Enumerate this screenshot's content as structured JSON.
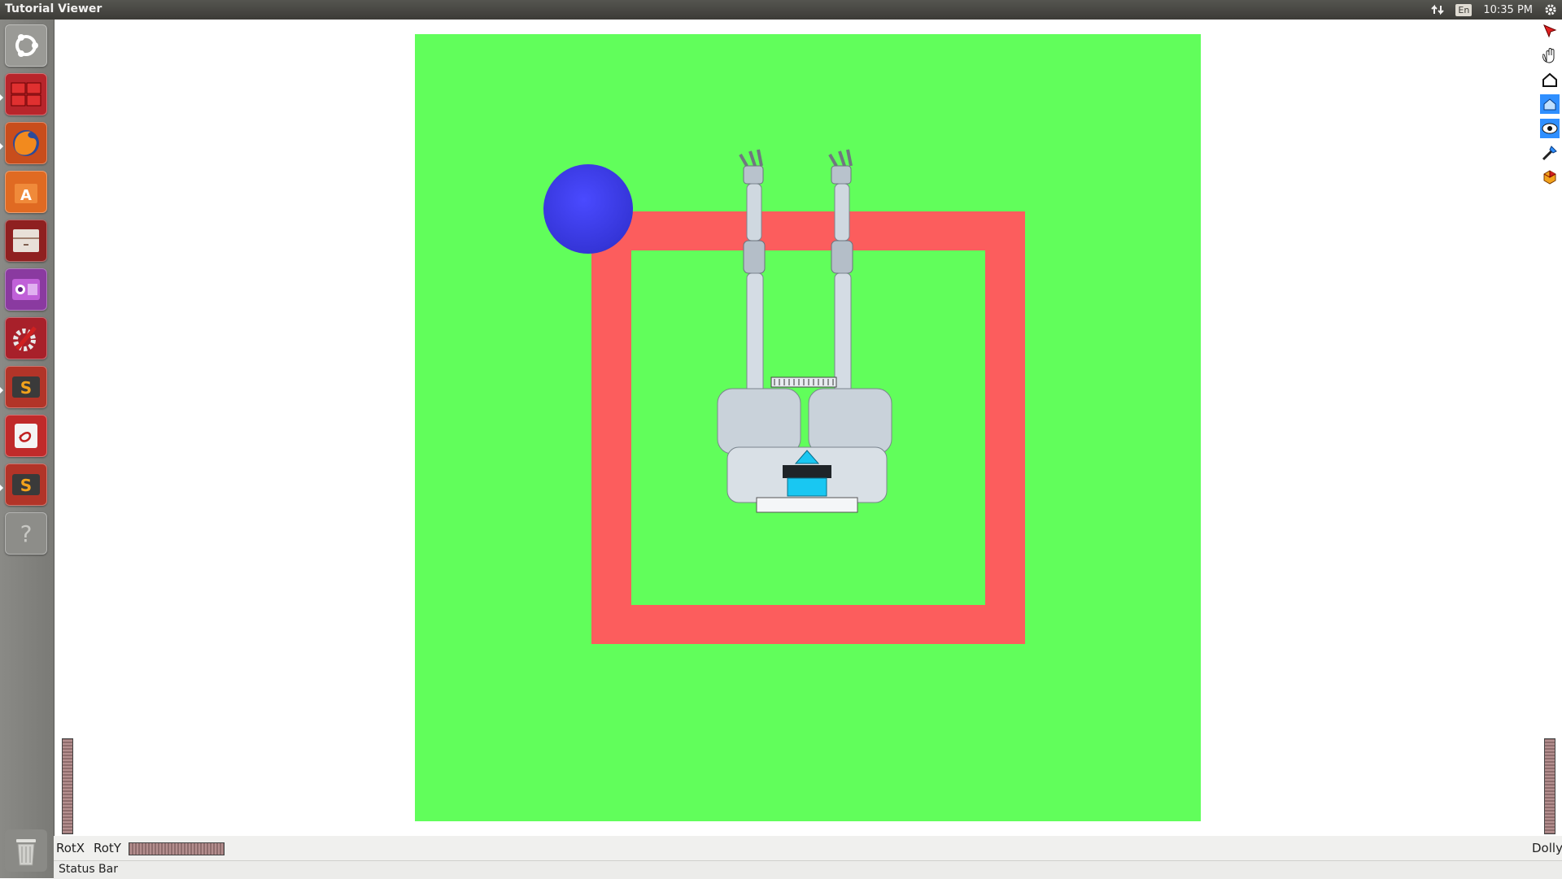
{
  "window": {
    "title": "Tutorial Viewer"
  },
  "topbar": {
    "lang": "En",
    "time": "10:35 PM"
  },
  "launcher": {
    "items": [
      {
        "name": "dash",
        "color": "#9a9a96"
      },
      {
        "name": "workspace",
        "color": "#b8252b"
      },
      {
        "name": "firefox",
        "color": "#c84d1c"
      },
      {
        "name": "software-center",
        "color": "#e06a22"
      },
      {
        "name": "files",
        "color": "#8f2020"
      },
      {
        "name": "camera",
        "color": "#8a3aa0"
      },
      {
        "name": "settings",
        "color": "#a8202a"
      },
      {
        "name": "sublime",
        "color": "#b23428"
      },
      {
        "name": "text-app",
        "color": "#c02a2a"
      },
      {
        "name": "sublime-2",
        "color": "#b23428"
      },
      {
        "name": "help",
        "color": "#8d8d89"
      }
    ],
    "trash": "trash"
  },
  "viewer": {
    "scene_colors": {
      "floor": "#61fe5b",
      "frame": "#fc5d5d",
      "ball": "#3535d8",
      "robot": "#c9d2da",
      "accent": "#19c7f2"
    }
  },
  "toolbar": {
    "icons": [
      "select-arrow-icon",
      "hand-icon",
      "home-icon",
      "set-home-icon",
      "view-all-icon",
      "seek-icon",
      "projection-icon"
    ]
  },
  "bottom": {
    "rotx": "RotX",
    "roty": "RotY",
    "dolly": "Dolly"
  },
  "status": {
    "text": "Status Bar"
  }
}
